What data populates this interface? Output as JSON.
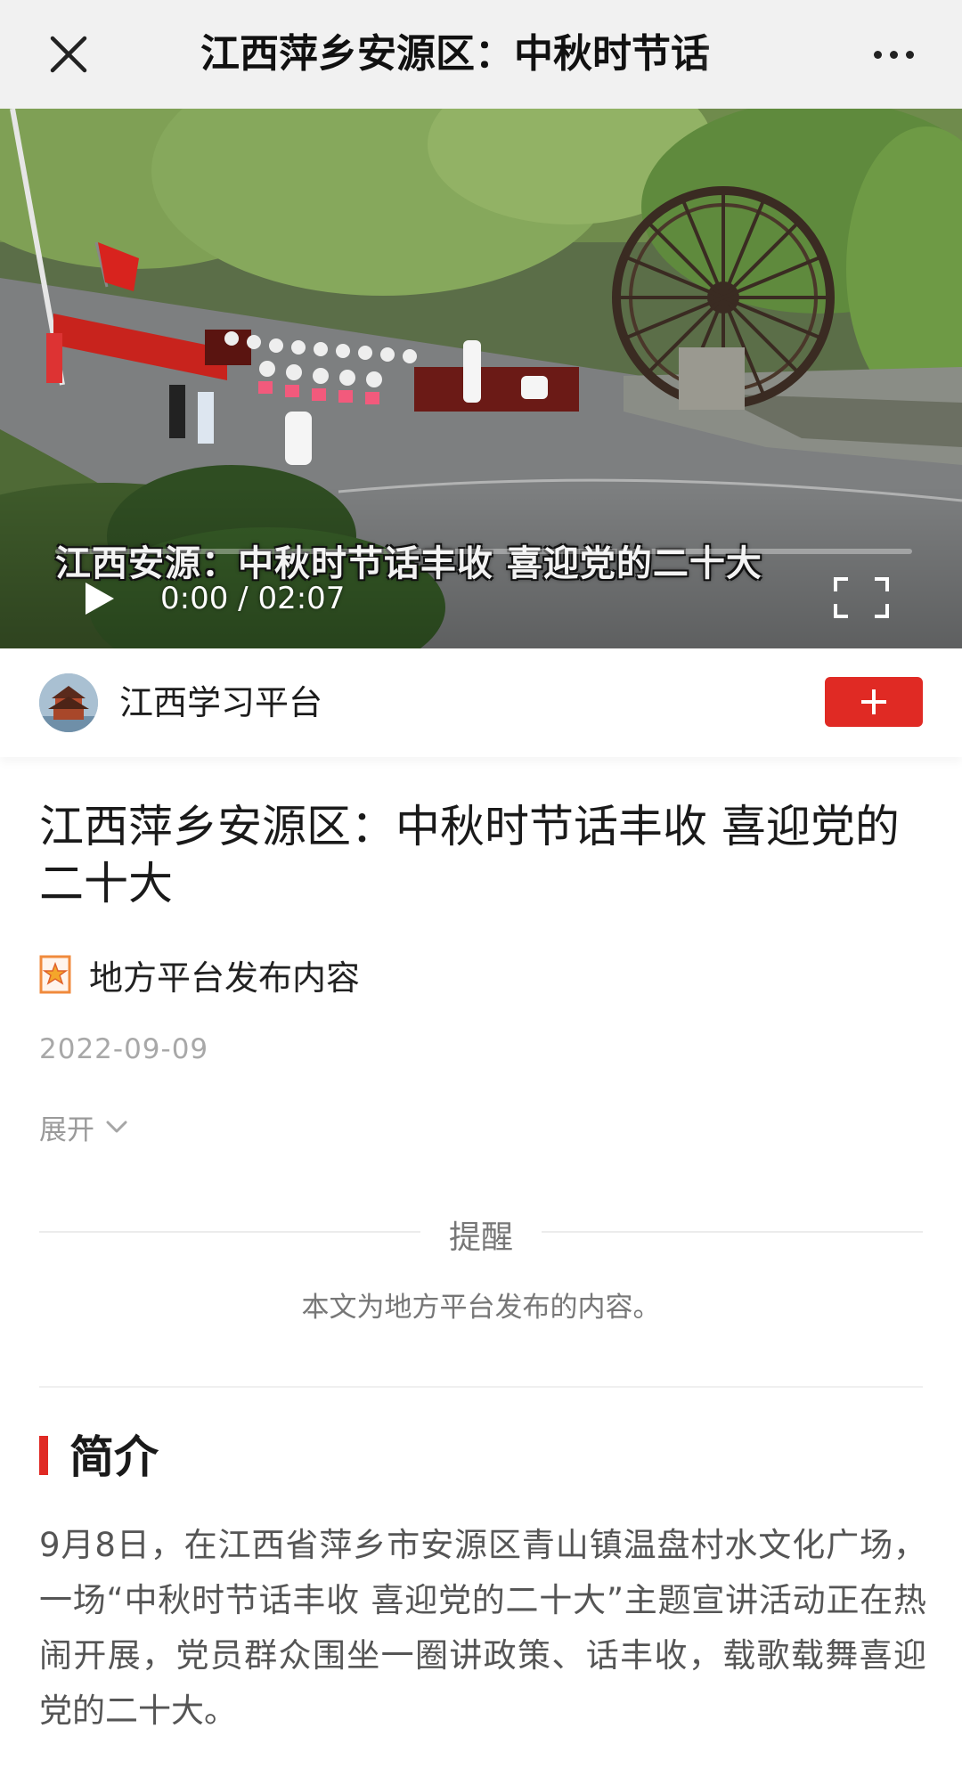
{
  "nav": {
    "title": "江西萍乡安源区：中秋时节话",
    "close_icon": "close-icon",
    "more_icon": "more-icon"
  },
  "video": {
    "caption": "江西安源：中秋时节话丰收 喜迎党的二十大",
    "current_time": "0:00",
    "separator": "/",
    "duration": "02:07",
    "progress": 0,
    "play_icon": "play-icon",
    "fullscreen_icon": "fullscreen-icon"
  },
  "account": {
    "name": "江西学习平台",
    "follow_icon": "plus-icon",
    "follow_color": "#e02a24"
  },
  "article": {
    "title": "江西萍乡安源区：中秋时节话丰收 喜迎党的二十大",
    "source_label": "地方平台发布内容",
    "date": "2022-09-09",
    "expand_label": "展开"
  },
  "notice": {
    "title": "提醒",
    "text": "本文为地方平台发布的内容。"
  },
  "intro": {
    "heading": "简介",
    "body": "9月8日，在江西省萍乡市安源区青山镇温盘村水文化广场，一场“中秋时节话丰收 喜迎党的二十大”主题宣讲活动正在热闹开展，党员群众围坐一圈讲政策、话丰收，载歌载舞喜迎党的二十大。",
    "accent_color": "#e02a24"
  }
}
